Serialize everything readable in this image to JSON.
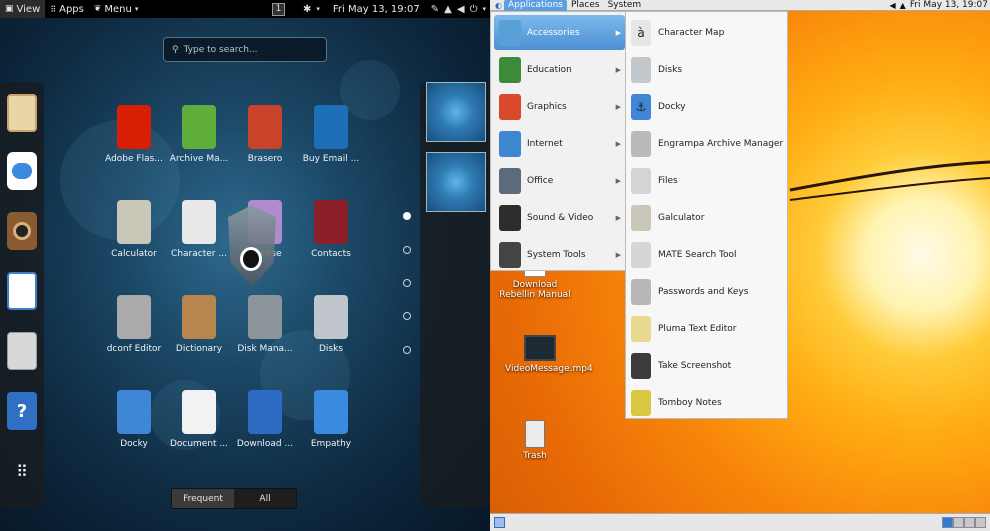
{
  "gnome": {
    "topbar": {
      "view": "View",
      "apps": "Apps",
      "menu": "Menu",
      "workspace": "1",
      "datetime": "Fri May 13, 19:07"
    },
    "search_placeholder": "Type to search...",
    "apps": [
      {
        "label": "Adobe Flas...",
        "color": "#d81e05"
      },
      {
        "label": "Archive Ma...",
        "color": "#5fae3b"
      },
      {
        "label": "Brasero",
        "color": "#c8432a"
      },
      {
        "label": "Buy Email ...",
        "color": "#1d6fb8"
      },
      {
        "label": "Calculator",
        "color": "#c9c7b8"
      },
      {
        "label": "Character ...",
        "color": "#e8e8e8"
      },
      {
        "label": "Cheese",
        "color": "#b28ad0"
      },
      {
        "label": "Contacts",
        "color": "#8c1f2a"
      },
      {
        "label": "dconf Editor",
        "color": "#aaaaaa"
      },
      {
        "label": "Dictionary",
        "color": "#b7864f"
      },
      {
        "label": "Disk Mana...",
        "color": "#8c959c"
      },
      {
        "label": "Disks",
        "color": "#bfc5ca"
      },
      {
        "label": "Docky",
        "color": "#3f86d6"
      },
      {
        "label": "Document ...",
        "color": "#f2f2f2"
      },
      {
        "label": "Download ...",
        "color": "#2e6bc2"
      },
      {
        "label": "Empathy",
        "color": "#3a8ae0"
      }
    ],
    "tabs": {
      "frequent": "Frequent",
      "all": "All"
    }
  },
  "mate": {
    "panel": {
      "applications": "Applications",
      "places": "Places",
      "system": "System",
      "datetime": "Fri May 13, 19:07"
    },
    "categories": [
      {
        "label": "Accessories",
        "color": "#5aa0d8"
      },
      {
        "label": "Education",
        "color": "#3c8b3a"
      },
      {
        "label": "Graphics",
        "color": "#d8492e"
      },
      {
        "label": "Internet",
        "color": "#3d86d0"
      },
      {
        "label": "Office",
        "color": "#5b6b7a"
      },
      {
        "label": "Sound & Video",
        "color": "#2d2d2d"
      },
      {
        "label": "System Tools",
        "color": "#444444"
      }
    ],
    "accessories": [
      {
        "label": "Character Map",
        "glyph": "à",
        "color": "#e6e6e6"
      },
      {
        "label": "Disks",
        "glyph": "",
        "color": "#c3c8cc"
      },
      {
        "label": "Docky",
        "glyph": "⚓",
        "color": "#3f86d6"
      },
      {
        "label": "Engrampa Archive Manager",
        "glyph": "",
        "color": "#b9b9b9"
      },
      {
        "label": "Files",
        "glyph": "",
        "color": "#d4d4d4"
      },
      {
        "label": "Galculator",
        "glyph": "",
        "color": "#c9c7b8"
      },
      {
        "label": "MATE Search Tool",
        "glyph": "",
        "color": "#d6d6d6"
      },
      {
        "label": "Passwords and Keys",
        "glyph": "",
        "color": "#b7b7b7"
      },
      {
        "label": "Pluma Text Editor",
        "glyph": "",
        "color": "#e8d890"
      },
      {
        "label": "Take Screenshot",
        "glyph": "",
        "color": "#3b3b3b"
      },
      {
        "label": "Tomboy Notes",
        "glyph": "",
        "color": "#d8c840"
      }
    ],
    "desktop_icons": [
      {
        "label": "Download Rebellin Manual"
      },
      {
        "label": "VideoMessage.mp4"
      },
      {
        "label": "Trash"
      }
    ]
  }
}
